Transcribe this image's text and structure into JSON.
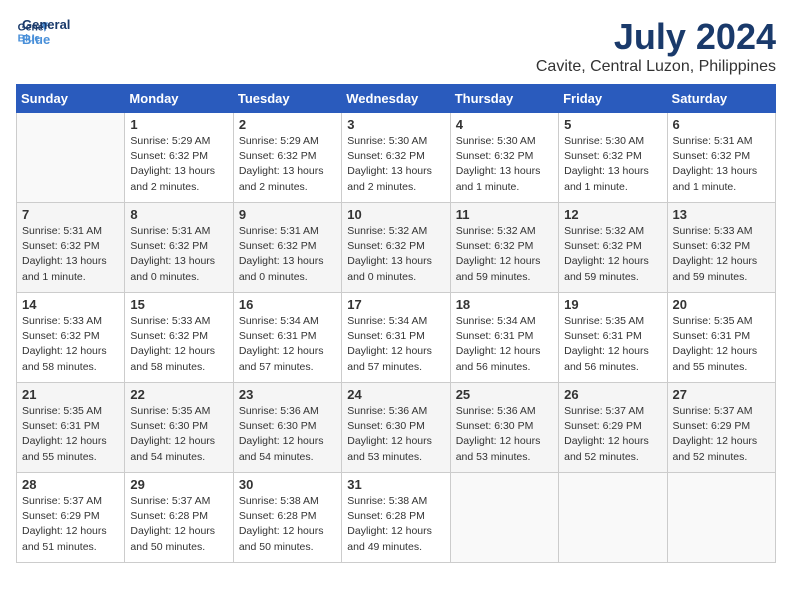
{
  "logo": {
    "name": "General",
    "name2": "Blue"
  },
  "title": "July 2024",
  "subtitle": "Cavite, Central Luzon, Philippines",
  "days_of_week": [
    "Sunday",
    "Monday",
    "Tuesday",
    "Wednesday",
    "Thursday",
    "Friday",
    "Saturday"
  ],
  "weeks": [
    [
      {
        "day": "",
        "info": ""
      },
      {
        "day": "1",
        "info": "Sunrise: 5:29 AM\nSunset: 6:32 PM\nDaylight: 13 hours\nand 2 minutes."
      },
      {
        "day": "2",
        "info": "Sunrise: 5:29 AM\nSunset: 6:32 PM\nDaylight: 13 hours\nand 2 minutes."
      },
      {
        "day": "3",
        "info": "Sunrise: 5:30 AM\nSunset: 6:32 PM\nDaylight: 13 hours\nand 2 minutes."
      },
      {
        "day": "4",
        "info": "Sunrise: 5:30 AM\nSunset: 6:32 PM\nDaylight: 13 hours\nand 1 minute."
      },
      {
        "day": "5",
        "info": "Sunrise: 5:30 AM\nSunset: 6:32 PM\nDaylight: 13 hours\nand 1 minute."
      },
      {
        "day": "6",
        "info": "Sunrise: 5:31 AM\nSunset: 6:32 PM\nDaylight: 13 hours\nand 1 minute."
      }
    ],
    [
      {
        "day": "7",
        "info": "Sunrise: 5:31 AM\nSunset: 6:32 PM\nDaylight: 13 hours\nand 1 minute."
      },
      {
        "day": "8",
        "info": "Sunrise: 5:31 AM\nSunset: 6:32 PM\nDaylight: 13 hours\nand 0 minutes."
      },
      {
        "day": "9",
        "info": "Sunrise: 5:31 AM\nSunset: 6:32 PM\nDaylight: 13 hours\nand 0 minutes."
      },
      {
        "day": "10",
        "info": "Sunrise: 5:32 AM\nSunset: 6:32 PM\nDaylight: 13 hours\nand 0 minutes."
      },
      {
        "day": "11",
        "info": "Sunrise: 5:32 AM\nSunset: 6:32 PM\nDaylight: 12 hours\nand 59 minutes."
      },
      {
        "day": "12",
        "info": "Sunrise: 5:32 AM\nSunset: 6:32 PM\nDaylight: 12 hours\nand 59 minutes."
      },
      {
        "day": "13",
        "info": "Sunrise: 5:33 AM\nSunset: 6:32 PM\nDaylight: 12 hours\nand 59 minutes."
      }
    ],
    [
      {
        "day": "14",
        "info": "Sunrise: 5:33 AM\nSunset: 6:32 PM\nDaylight: 12 hours\nand 58 minutes."
      },
      {
        "day": "15",
        "info": "Sunrise: 5:33 AM\nSunset: 6:32 PM\nDaylight: 12 hours\nand 58 minutes."
      },
      {
        "day": "16",
        "info": "Sunrise: 5:34 AM\nSunset: 6:31 PM\nDaylight: 12 hours\nand 57 minutes."
      },
      {
        "day": "17",
        "info": "Sunrise: 5:34 AM\nSunset: 6:31 PM\nDaylight: 12 hours\nand 57 minutes."
      },
      {
        "day": "18",
        "info": "Sunrise: 5:34 AM\nSunset: 6:31 PM\nDaylight: 12 hours\nand 56 minutes."
      },
      {
        "day": "19",
        "info": "Sunrise: 5:35 AM\nSunset: 6:31 PM\nDaylight: 12 hours\nand 56 minutes."
      },
      {
        "day": "20",
        "info": "Sunrise: 5:35 AM\nSunset: 6:31 PM\nDaylight: 12 hours\nand 55 minutes."
      }
    ],
    [
      {
        "day": "21",
        "info": "Sunrise: 5:35 AM\nSunset: 6:31 PM\nDaylight: 12 hours\nand 55 minutes."
      },
      {
        "day": "22",
        "info": "Sunrise: 5:35 AM\nSunset: 6:30 PM\nDaylight: 12 hours\nand 54 minutes."
      },
      {
        "day": "23",
        "info": "Sunrise: 5:36 AM\nSunset: 6:30 PM\nDaylight: 12 hours\nand 54 minutes."
      },
      {
        "day": "24",
        "info": "Sunrise: 5:36 AM\nSunset: 6:30 PM\nDaylight: 12 hours\nand 53 minutes."
      },
      {
        "day": "25",
        "info": "Sunrise: 5:36 AM\nSunset: 6:30 PM\nDaylight: 12 hours\nand 53 minutes."
      },
      {
        "day": "26",
        "info": "Sunrise: 5:37 AM\nSunset: 6:29 PM\nDaylight: 12 hours\nand 52 minutes."
      },
      {
        "day": "27",
        "info": "Sunrise: 5:37 AM\nSunset: 6:29 PM\nDaylight: 12 hours\nand 52 minutes."
      }
    ],
    [
      {
        "day": "28",
        "info": "Sunrise: 5:37 AM\nSunset: 6:29 PM\nDaylight: 12 hours\nand 51 minutes."
      },
      {
        "day": "29",
        "info": "Sunrise: 5:37 AM\nSunset: 6:28 PM\nDaylight: 12 hours\nand 50 minutes."
      },
      {
        "day": "30",
        "info": "Sunrise: 5:38 AM\nSunset: 6:28 PM\nDaylight: 12 hours\nand 50 minutes."
      },
      {
        "day": "31",
        "info": "Sunrise: 5:38 AM\nSunset: 6:28 PM\nDaylight: 12 hours\nand 49 minutes."
      },
      {
        "day": "",
        "info": ""
      },
      {
        "day": "",
        "info": ""
      },
      {
        "day": "",
        "info": ""
      }
    ]
  ]
}
